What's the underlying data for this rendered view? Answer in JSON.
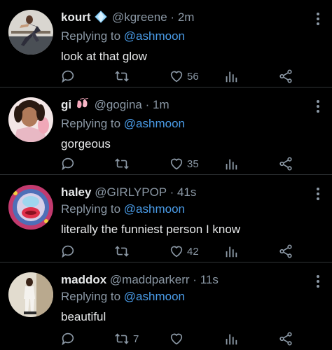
{
  "replies": [
    {
      "name": "kourt",
      "badge": "blue-diamond",
      "handle": "@kgreene",
      "separator": "·",
      "time": "2m",
      "replying_prefix": "Replying to",
      "replying_to": "@ashmoon",
      "text": "look at that glow",
      "reply_count": "",
      "retweet_count": "",
      "like_count": "56"
    },
    {
      "name": "gi",
      "badge": "ballet-shoes",
      "handle": "@gogina",
      "separator": "·",
      "time": "1m",
      "replying_prefix": "Replying to",
      "replying_to": "@ashmoon",
      "text": "gorgeous",
      "reply_count": "",
      "retweet_count": "",
      "like_count": "35"
    },
    {
      "name": "haley",
      "badge": "",
      "handle": "@GIRLYPOP",
      "separator": "·",
      "time": "41s",
      "replying_prefix": "Replying to",
      "replying_to": "@ashmoon",
      "text": "literally the funniest person I know",
      "reply_count": "",
      "retweet_count": "",
      "like_count": "42"
    },
    {
      "name": "maddox",
      "badge": "",
      "handle": "@maddparkerr",
      "separator": "·",
      "time": "11s",
      "replying_prefix": "Replying to",
      "replying_to": "@ashmoon",
      "text": "beautiful",
      "reply_count": "",
      "retweet_count": "7",
      "like_count": ""
    }
  ],
  "icons": {
    "reply": "speech-bubble-icon",
    "retweet": "retweet-arrows-icon",
    "like": "heart-outline-icon",
    "stats": "bar-chart-icon",
    "share": "share-nodes-icon",
    "more": "vertical-ellipsis-icon"
  },
  "colors": {
    "background": "#000000",
    "primary_text": "#e7e9ea",
    "secondary_text": "#8b98a5",
    "mention": "#4a9ce8",
    "divider": "#2f3336"
  }
}
